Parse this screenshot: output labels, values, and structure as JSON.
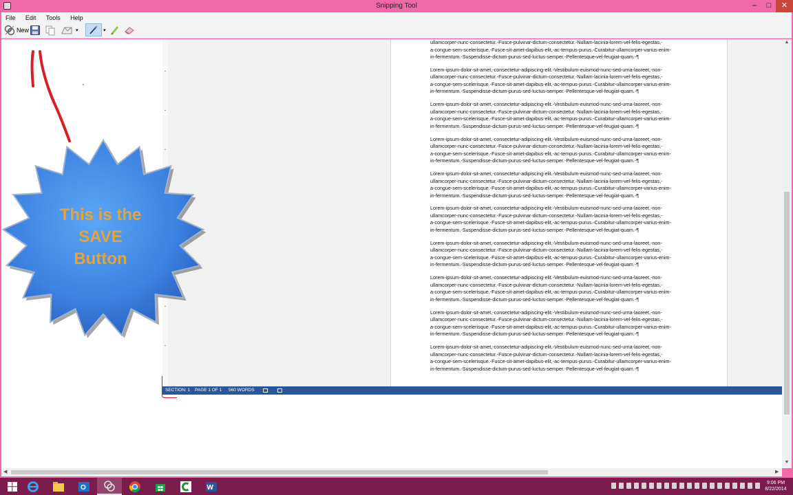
{
  "window": {
    "title": "Snipping Tool",
    "minimize": "–",
    "maximize": "□",
    "close": "✕"
  },
  "menu": [
    "File",
    "Edit",
    "Tools",
    "Help"
  ],
  "toolbar": {
    "new_label": "New",
    "dropdown_arrow": "▾"
  },
  "document": {
    "first_lines": [
      "ullamcorper-nunc-consectetur.-Fusce-pulvinar-dictum-consectetur.-Nullam-lacinia-lorem-vel-felis-egestas,-",
      "a-congue-sem-scelerisque.-Fusce-sit-amet-dapibus-elit,-ac-tempus-purus.-Curabitur-ullamcorper-varius-enim-",
      "in-fermentum.-Suspendisse-dictum-purus-sed-luctus-semper.-Pellentesque-vel-feugiat-quam.-¶"
    ],
    "paragraph_lines": [
      "Lorem-ipsum-dolor-sit-amet,-consectetur-adipiscing-elit.-Vestibulum-euismod-nunc-sed-urna-laoreet,-non-",
      "ullamcorper-nunc-consectetur.-Fusce-pulvinar-dictum-consectetur.-Nullam-lacinia-lorem-vel-felis-egestas,-",
      "a-congue-sem-scelerisque.-Fusce-sit-amet-dapibus-elit,-ac-tempus-purus.-Curabitur-ullamcorper-varius-enim-",
      "in-fermentum.-Suspendisse-dictum-purus-sed-luctus-semper.-Pellentesque-vel-feugiat-quam.-¶"
    ],
    "status": {
      "section": "SECTION: 1",
      "page": "PAGE 1 OF 1",
      "words": "560 WORDS"
    }
  },
  "annotation": {
    "line1": "This is the",
    "line2": "SAVE",
    "line3": "Button"
  },
  "scroll": {
    "up": "▲",
    "down": "▼",
    "left": "◀",
    "right": "▶"
  },
  "clock": {
    "time": "9:06 PM",
    "date": "8/22/2014"
  },
  "colors": {
    "titlebar": "#ef6aa6",
    "desktop": "#e23b8f",
    "star_fill": "#3d86e6",
    "star_text": "#e8a336",
    "pen_stroke": "#d81f26",
    "word_status": "#2b579a"
  }
}
